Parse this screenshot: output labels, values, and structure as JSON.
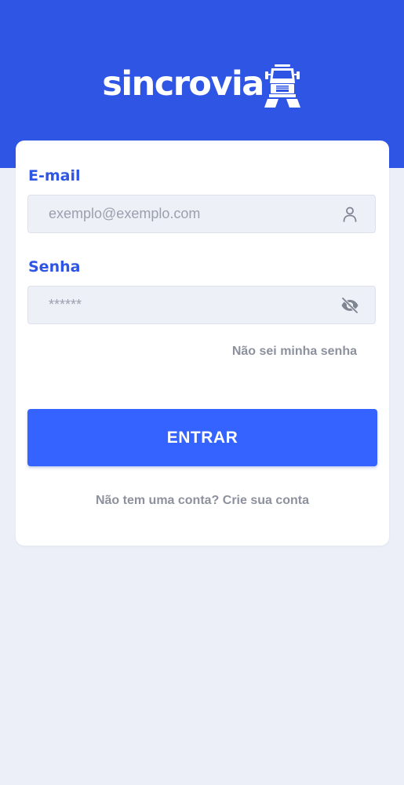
{
  "brand": {
    "logo_text": "sincrovia",
    "logo_icon": "truck-icon",
    "primary_color": "#2f55e4",
    "button_color": "#3563ff",
    "background_color": "#eceff8"
  },
  "login": {
    "email": {
      "label": "E-mail",
      "placeholder": "exemplo@exemplo.com",
      "value": "",
      "icon": "user-icon"
    },
    "password": {
      "label": "Senha",
      "placeholder": "******",
      "value": "",
      "icon": "eye-off-icon"
    },
    "forgot_password": "Não sei minha senha",
    "submit_label": "ENTRAR",
    "signup_prompt": "Não tem uma conta? Crie sua conta"
  }
}
